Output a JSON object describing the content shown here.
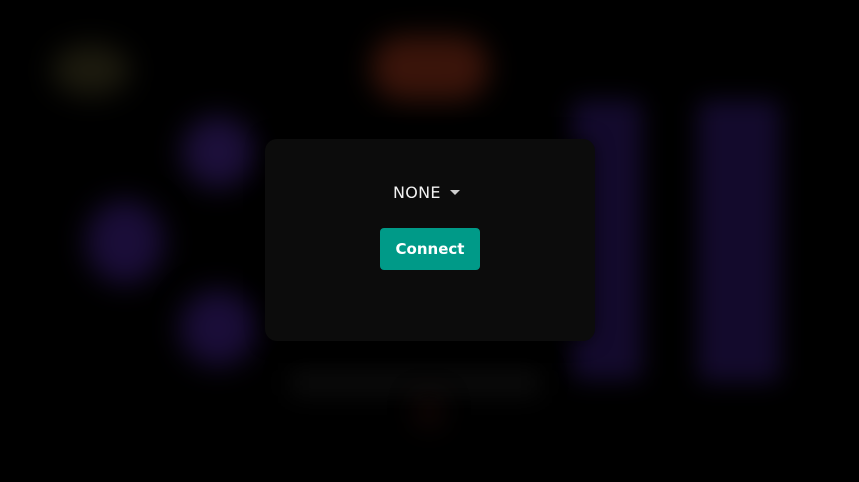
{
  "device_select": {
    "value": "NONE",
    "icon": "caret-down-icon"
  },
  "connect_button": {
    "label": "Connect",
    "color": "#009a88"
  },
  "background": {
    "color": "#000000",
    "panel_color": "#0c0c0c"
  }
}
